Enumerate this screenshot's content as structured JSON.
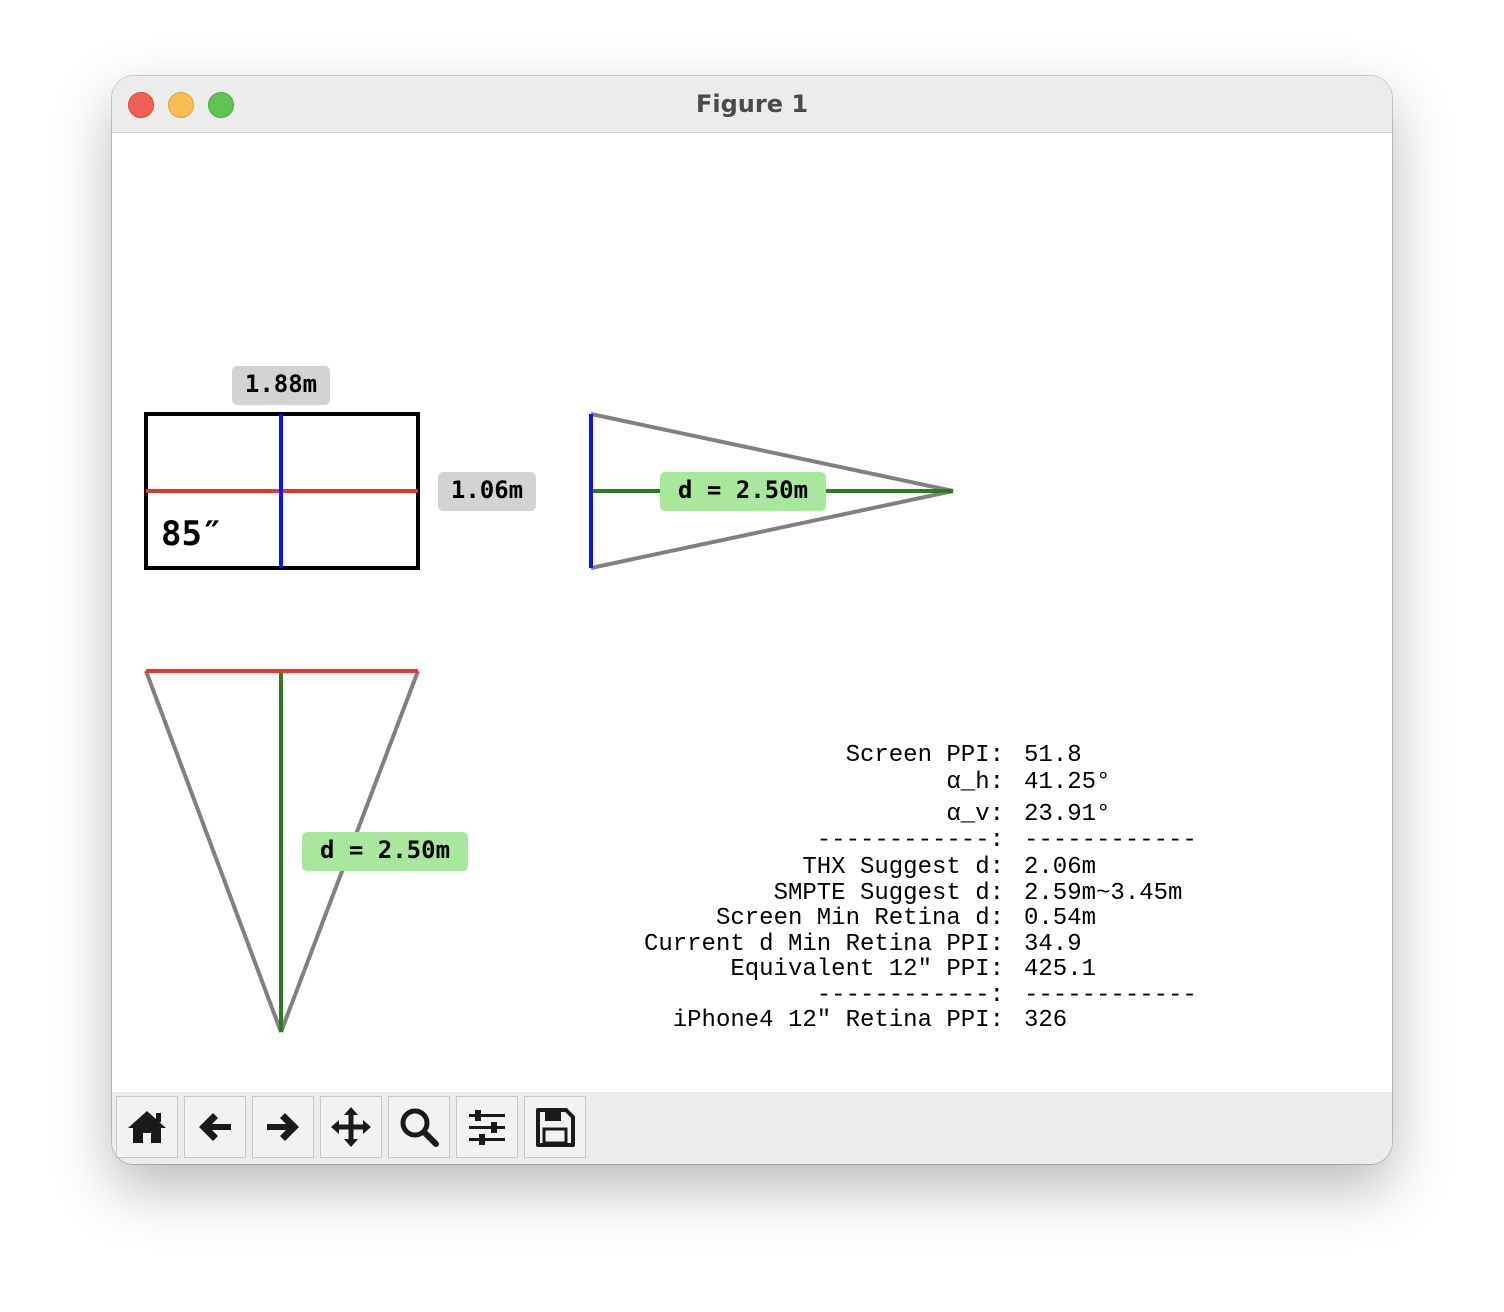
{
  "window": {
    "title": "Figure 1"
  },
  "figure": {
    "screen_diagram": {
      "width_label": "1.88m",
      "height_label": "1.06m",
      "diagonal_label": "85″"
    },
    "side_view": {
      "distance_label": "d = 2.50m"
    },
    "top_view": {
      "distance_label": "d = 2.50m"
    },
    "stats": [
      {
        "key": "Screen PPI:",
        "value": "51.8"
      },
      {
        "key": "α_h:",
        "value": "41.25°"
      },
      {
        "key": "α_v:",
        "value": "23.91°"
      },
      {
        "key": "------------:",
        "value": "------------"
      },
      {
        "key": "THX Suggest d:",
        "value": "2.06m"
      },
      {
        "key": "SMPTE Suggest d:",
        "value": "2.59m~3.45m"
      },
      {
        "key": "Screen Min Retina d:",
        "value": "0.54m"
      },
      {
        "key": "Current d Min Retina PPI:",
        "value": "34.9"
      },
      {
        "key": "Equivalent 12″ PPI:",
        "value": "425.1"
      },
      {
        "key": "------------:",
        "value": "------------"
      },
      {
        "key": "iPhone4 12″ Retina PPI:",
        "value": "326"
      }
    ]
  },
  "toolbar": {
    "buttons": [
      {
        "name": "home-button",
        "icon": "home-icon"
      },
      {
        "name": "back-button",
        "icon": "arrow-left-icon"
      },
      {
        "name": "forward-button",
        "icon": "arrow-right-icon"
      },
      {
        "name": "pan-button",
        "icon": "move-icon"
      },
      {
        "name": "zoom-button",
        "icon": "magnifier-icon"
      },
      {
        "name": "configure-subplots-button",
        "icon": "sliders-icon"
      },
      {
        "name": "save-button",
        "icon": "floppy-disk-icon"
      }
    ]
  },
  "colors": {
    "width_line": "#e8352c",
    "height_line": "#0a14f0",
    "distance_line": "#2e7a1e",
    "sight_lines": "#808080",
    "label_gray": "#d3d3d3",
    "label_green": "#a8e89c"
  }
}
